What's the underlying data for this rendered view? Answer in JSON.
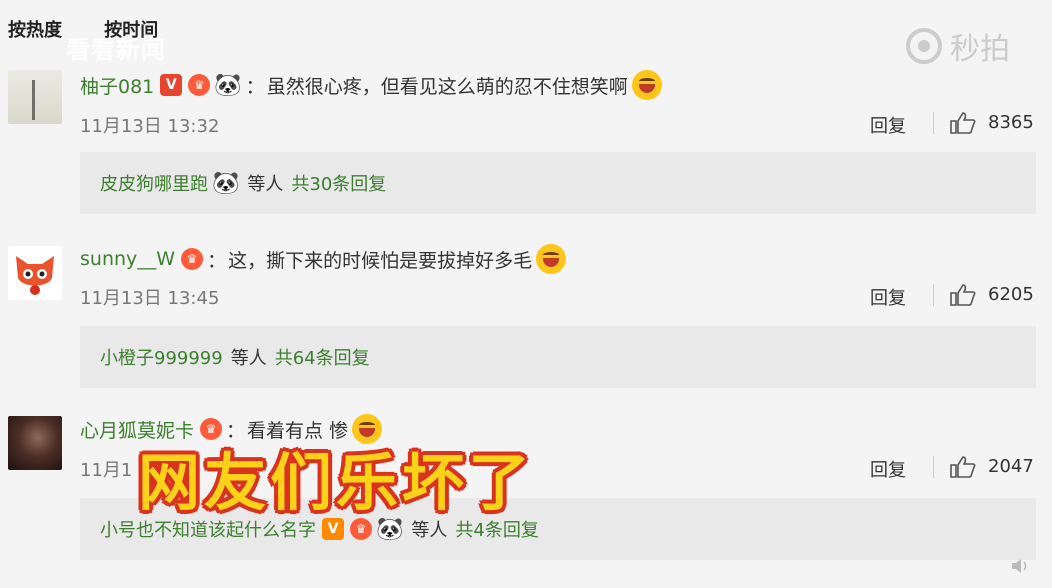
{
  "tabs": [
    "按热度",
    "按时间"
  ],
  "watermarks": {
    "left": "看看新闻",
    "right": "秒拍"
  },
  "comments": [
    {
      "user": "柚子081",
      "text": "虽然很心疼，但看见这么萌的忍不住想笑啊",
      "time": "11月13日 13:32",
      "reply_label": "回复",
      "likes": "8365",
      "replies": {
        "user": "皮皮狗哪里跑",
        "text": "等人",
        "count": "共30条回复"
      }
    },
    {
      "user": "sunny__W",
      "text": "这，撕下来的时候怕是要拔掉好多毛",
      "time": "11月13日 13:45",
      "reply_label": "回复",
      "likes": "6205",
      "replies": {
        "user": "小橙子999999",
        "text": "等人",
        "count": "共64条回复"
      }
    },
    {
      "user": "心月狐莫妮卡",
      "text": "看着有点 惨",
      "time": "11月1",
      "reply_label": "回复",
      "likes": "2047",
      "replies": {
        "user": "小号也不知道该起什么名字",
        "text": "等人",
        "count": "共4条回复"
      }
    }
  ],
  "caption": "网友们乐坏了",
  "colors": {
    "username": "#3c7f2e",
    "caption_fill": "#ffd21a",
    "caption_stroke": "#d9331f"
  }
}
